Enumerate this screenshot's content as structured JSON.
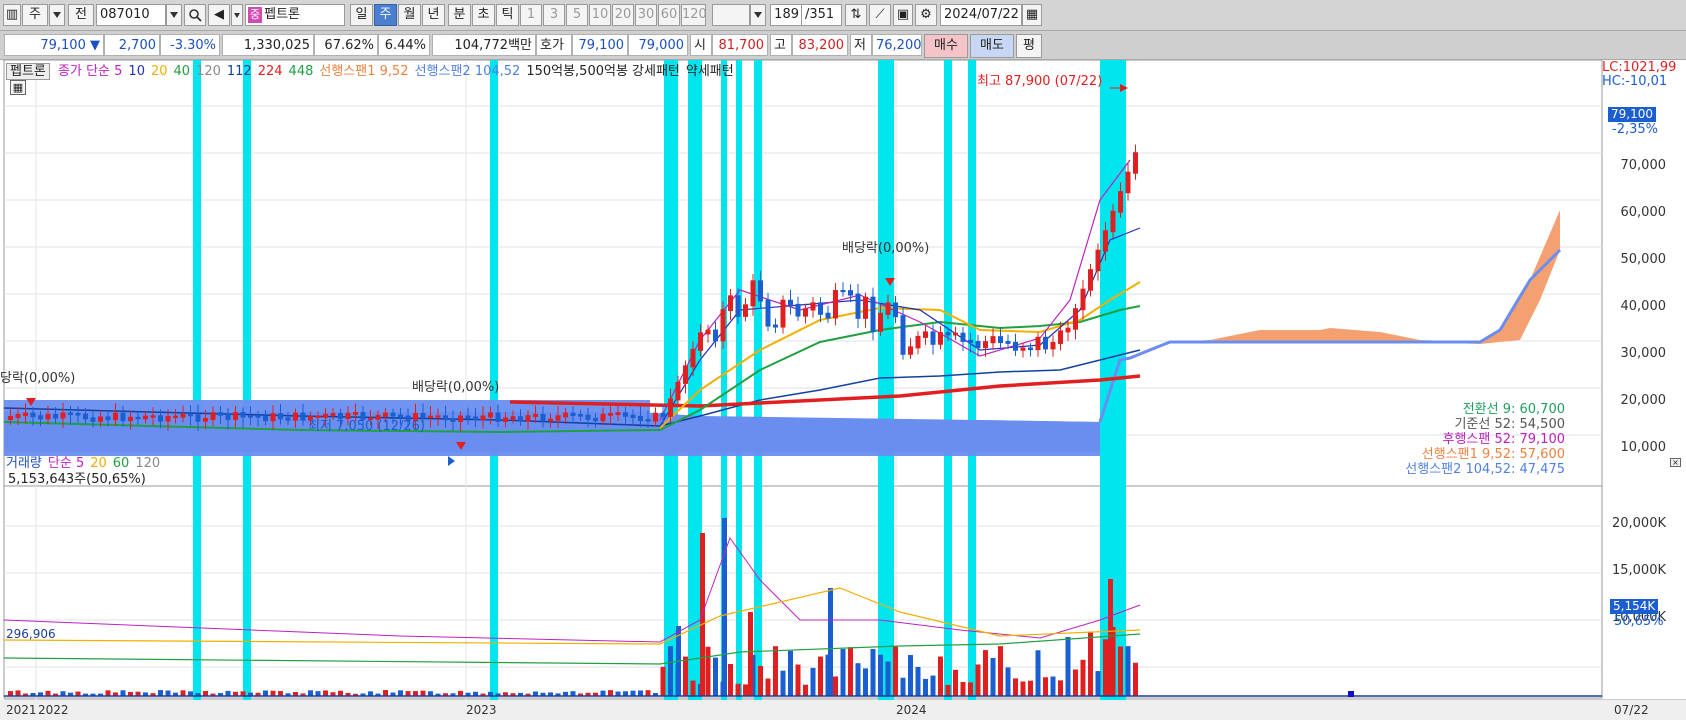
{
  "toolbar": {
    "tab_jusik": "주",
    "tab_jeon": "전",
    "code": "087010",
    "stock_tag": "중",
    "stock_name": "펩트론",
    "periods": [
      "일",
      "주",
      "월",
      "년",
      "분",
      "초",
      "틱"
    ],
    "selected_period": "주",
    "intervals": [
      "1",
      "3",
      "5",
      "10",
      "20",
      "30",
      "60",
      "120"
    ],
    "count_current": "189",
    "count_total": "/351",
    "date": "2024/07/22"
  },
  "quote": {
    "price": "79,100",
    "change": "2,700",
    "change_pct": "-3.30%",
    "volume": "1,330,025",
    "volume_ratio": "67.62%",
    "turnover": "6.44%",
    "amount": "104,772백만",
    "hoga_label": "호가",
    "ask": "79,100",
    "bid": "79,000",
    "open_label": "시",
    "open": "81,700",
    "high_label": "고",
    "high": "83,200",
    "low_label": "저",
    "low": "76,200",
    "buy_label": "매수",
    "sell_label": "매도",
    "eval_label": "평"
  },
  "price_panel": {
    "stock_label": "펩트론",
    "legend": [
      {
        "text": "종가 단순 5",
        "color": "#c020c0"
      },
      {
        "text": "10",
        "color": "#2030c0"
      },
      {
        "text": "20",
        "color": "#f0b000"
      },
      {
        "text": "40",
        "color": "#20a040"
      },
      {
        "text": "120",
        "color": "#888888"
      },
      {
        "text": "112",
        "color": "#1040a0"
      },
      {
        "text": "224",
        "color": "#e02020"
      },
      {
        "text": "448",
        "color": "#20a040"
      },
      {
        "text": "선행스팬1 9,52",
        "color": "#f08040"
      },
      {
        "text": "선행스팬2 104,52",
        "color": "#5080e0"
      },
      {
        "text": "150억봉,500억봉 강세패턴",
        "color": "#222222"
      },
      {
        "text": "약세패턴",
        "color": "#222222"
      }
    ],
    "lc": "LC:1021,99",
    "hc": "HC:-10,01",
    "price_badge": "79,100",
    "pct_badge": "-2,35%",
    "y_ticks": [
      "70,000",
      "60,000",
      "50,000",
      "40,000",
      "30,000",
      "20,000",
      "10,000"
    ],
    "annotations": {
      "high": "최고 87,900 (07/22)",
      "low": "최저 7,050 (12/26)",
      "div1": "배당락(0,00%)",
      "div2": "배당락(0,00%)",
      "div3": "당락(0,00%)"
    },
    "ichimoku": [
      {
        "text": "전환선 9: 60,700",
        "color": "#20a060"
      },
      {
        "text": "기준선 52: 54,500",
        "color": "#555555"
      },
      {
        "text": "후행스팬 52: 79,100",
        "color": "#c020c0"
      },
      {
        "text": "선행스팬1 9,52: 57,600",
        "color": "#f08040"
      },
      {
        "text": "선행스팬2 104,52: 47,475",
        "color": "#5080e0"
      }
    ]
  },
  "volume_panel": {
    "legend": [
      {
        "text": "거래량",
        "color": "#2050c0"
      },
      {
        "text": "단순 5",
        "color": "#c020c0"
      },
      {
        "text": "20",
        "color": "#f0b000"
      },
      {
        "text": "60",
        "color": "#20a040"
      },
      {
        "text": "120",
        "color": "#888888"
      }
    ],
    "current": "5,153,643주(50,65%)",
    "y_ticks": [
      "20,000K",
      "15,000K",
      "10,000K"
    ],
    "vol_badge": "5,154K",
    "pct_badge": "50,65%",
    "min_label": "296,906"
  },
  "x_axis": {
    "labels": [
      "2021",
      "2022",
      "2023",
      "2024"
    ],
    "end_date": "07/22"
  },
  "colors": {
    "up": "#e02020",
    "down": "#1b5ed0",
    "highlight": "#00e5ee",
    "cloud_blue": "#6a8ef0",
    "cloud_orange": "#f4a070"
  }
}
